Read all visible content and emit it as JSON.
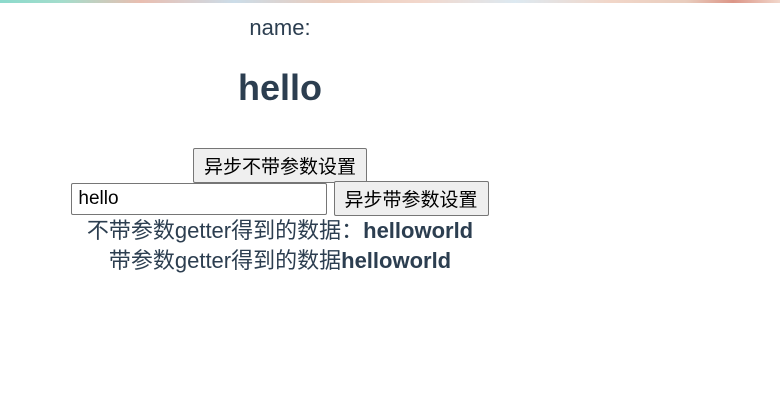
{
  "page": {
    "name_label": "name:",
    "title": "hello",
    "button_async_no_param": "异步不带参数设置",
    "input_value": "hello",
    "button_async_with_param": "异步带参数设置",
    "getter_no_param_label": "不带参数getter得到的数据：",
    "getter_no_param_value": "helloworld",
    "getter_with_param_label": "带参数getter得到的数据",
    "getter_with_param_value": "helloworld"
  }
}
